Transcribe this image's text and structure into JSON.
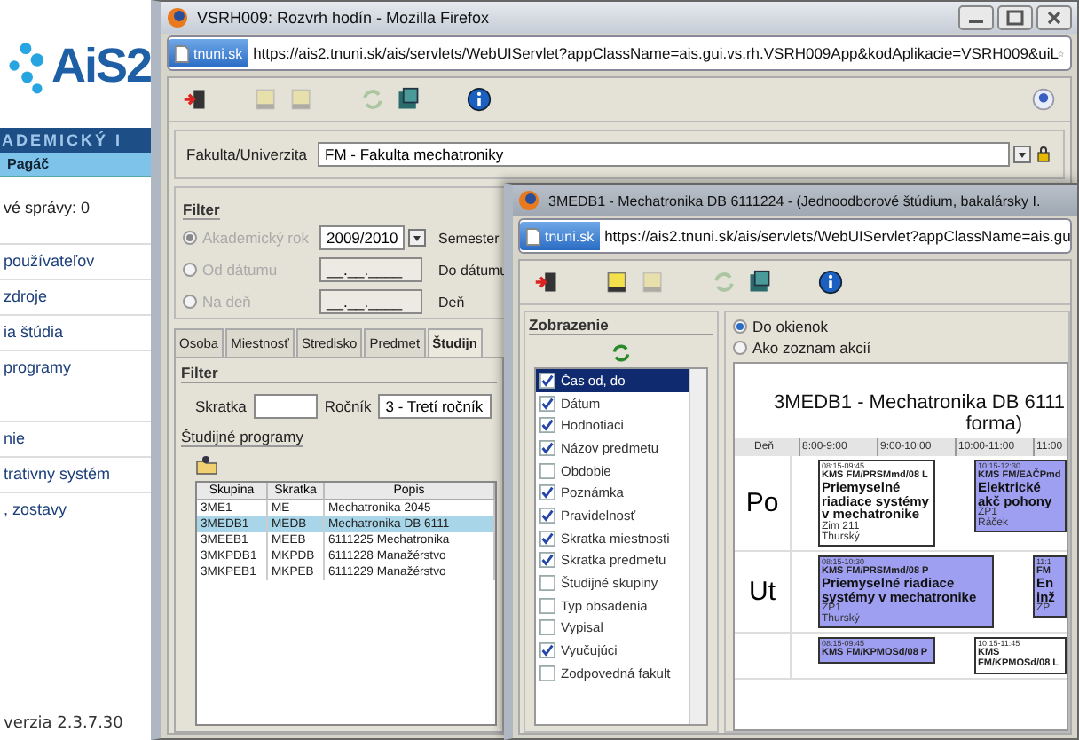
{
  "portal": {
    "logo": "AiS2",
    "banner": "ADEMICKÝ I",
    "user": "Pagáč",
    "messages": "vé správy: 0",
    "menu_groups": [
      [
        "používateľov",
        "zdroje",
        "ia štúdia",
        "programy"
      ],
      [
        "nie",
        "trativny systém",
        ", zostavy"
      ]
    ],
    "version": "verzia 2.3.7.30"
  },
  "main_window": {
    "title": "VSRH009: Rozvrh hodín - Mozilla Firefox",
    "site": "tnuni.sk",
    "url": "https://ais2.tnuni.sk/ais/servlets/WebUIServlet?appClassName=ais.gui.vs.rh.VSRH009App&kodAplikacie=VSRH009&uiL",
    "toolbar": [
      {
        "kind": "exit",
        "disabled": false
      },
      {
        "kind": "note",
        "disabled": true
      },
      {
        "kind": "note",
        "disabled": true
      },
      {
        "kind": "refresh",
        "disabled": true
      },
      {
        "kind": "save",
        "disabled": false
      },
      {
        "kind": "info",
        "disabled": false
      }
    ],
    "faculty_label": "Fakulta/Univerzita",
    "faculty_value": "FM - Fakulta mechatroniky",
    "filter": {
      "title": "Filter",
      "options": [
        {
          "label": "Akademický rok",
          "selected": true,
          "disabled": true
        },
        {
          "label": "Od dátumu",
          "selected": false,
          "disabled": true
        },
        {
          "label": "Na deň",
          "selected": false,
          "disabled": true
        }
      ],
      "year": "2009/2010",
      "dates": [
        "__.__.____",
        "__.__.____"
      ],
      "labels": [
        "Semester",
        "Do dátumu",
        "Deň"
      ]
    },
    "tabs": [
      {
        "label": "Osoba",
        "selected": false
      },
      {
        "label": "Miestnosť",
        "selected": false
      },
      {
        "label": "Stredisko",
        "selected": false
      },
      {
        "label": "Predmet",
        "selected": false
      },
      {
        "label": "Študijn",
        "selected": true
      }
    ],
    "inner_filter": {
      "title": "Filter",
      "code_label": "Skratka",
      "grade_label": "Ročník",
      "grade_value": "3 - Tretí ročník"
    },
    "programs": {
      "title": "Študijné programy",
      "columns": [
        "Skupina",
        "Skratka",
        "Popis"
      ],
      "rows": [
        {
          "cells": [
            "3ME1",
            "ME",
            "Mechatronika 2045"
          ],
          "selected": false
        },
        {
          "cells": [
            "3MEDB1",
            "MEDB",
            "Mechatronika DB 6111"
          ],
          "selected": true
        },
        {
          "cells": [
            "3MEEB1",
            "MEEB",
            "6111225 Mechatronika"
          ],
          "selected": false
        },
        {
          "cells": [
            "3MKPDB1",
            "MKPDB",
            "6111228 Manažérstvo"
          ],
          "selected": false
        },
        {
          "cells": [
            "3MKPEB1",
            "MKPEB",
            "6111229 Manažérstvo"
          ],
          "selected": false
        }
      ]
    }
  },
  "schedule_window": {
    "title": "3MEDB1 - Mechatronika DB 6111224 - (Jednoodborové štúdium, bakalársky I.",
    "site": "tnuni.sk",
    "url": "https://ais2.tnuni.sk/ais/servlets/WebUIServlet?appClassName=ais.gu",
    "toolbar": [
      {
        "kind": "exit",
        "disabled": false
      },
      {
        "kind": "note",
        "disabled": false
      },
      {
        "kind": "note",
        "disabled": true
      },
      {
        "kind": "refresh",
        "disabled": true
      },
      {
        "kind": "save",
        "disabled": false
      },
      {
        "kind": "info",
        "disabled": false
      }
    ],
    "view": {
      "title": "Zobrazenie",
      "items": [
        {
          "label": "Čas od, do",
          "checked": true,
          "selected": true
        },
        {
          "label": "Dátum",
          "checked": true,
          "selected": false
        },
        {
          "label": "Hodnotiaci",
          "checked": true,
          "selected": false
        },
        {
          "label": "Názov predmetu",
          "checked": true,
          "selected": false
        },
        {
          "label": "Obdobie",
          "checked": false,
          "selected": false
        },
        {
          "label": "Poznámka",
          "checked": true,
          "selected": false
        },
        {
          "label": "Pravidelnosť",
          "checked": true,
          "selected": false
        },
        {
          "label": "Skratka miestnosti",
          "checked": true,
          "selected": false
        },
        {
          "label": "Skratka predmetu",
          "checked": true,
          "selected": false
        },
        {
          "label": "Študijné skupiny",
          "checked": false,
          "selected": false
        },
        {
          "label": "Typ obsadenia",
          "checked": false,
          "selected": false
        },
        {
          "label": "Vypisal",
          "checked": false,
          "selected": false
        },
        {
          "label": "Vyučujúci",
          "checked": true,
          "selected": false
        },
        {
          "label": "Zodpovedná fakult",
          "checked": false,
          "selected": false
        }
      ]
    },
    "modes": [
      {
        "label": "Do okienok",
        "selected": true
      },
      {
        "label": "Ako zoznam akcií",
        "selected": false
      }
    ],
    "schedule": {
      "title": "3MEDB1 - Mechatronika DB 6111",
      "subtitle": "forma)",
      "columns": [
        "Deň",
        "8:00-9:00",
        "9:00-10:00",
        "10:00-11:00",
        "11:00"
      ],
      "rows": [
        {
          "day": "Po",
          "events": [
            {
              "time": "08:15-09:45",
              "code": "KMS FM/PRSMmd/08 L",
              "title": "Priemyselné riadiace systémy v mechatronike",
              "room": "Zim 211",
              "teacher": "Thurský",
              "color": "#ffffff"
            },
            {
              "time": "10:15-12:30",
              "code": "KMS FM/EAČPmd",
              "title": "Elektrické akč pohony",
              "room": "ZP1",
              "teacher": "Ráček",
              "color": "#9f9ff2"
            }
          ]
        },
        {
          "day": "Ut",
          "events": [
            {
              "time": "08:15-10:30",
              "code": "KMS FM/PRSMmd/08 P",
              "title": "Priemyselné riadiace systémy v mechatronike",
              "room": "ZP1",
              "teacher": "Thurský",
              "color": "#9f9ff2"
            },
            {
              "time": "11:1",
              "code": "FM",
              "title": "En inž",
              "room": "ZP",
              "color": "#9f9ff2"
            }
          ]
        },
        {
          "events": [
            {
              "time": "08:15-09:45",
              "code": "KMS FM/KPMOSd/08 P",
              "color": "#9f9ff2"
            },
            {
              "time": "10:15-11:45",
              "code": "KMS FM/KPMOSd/08 L",
              "color": "#ffffff"
            }
          ]
        }
      ]
    }
  }
}
